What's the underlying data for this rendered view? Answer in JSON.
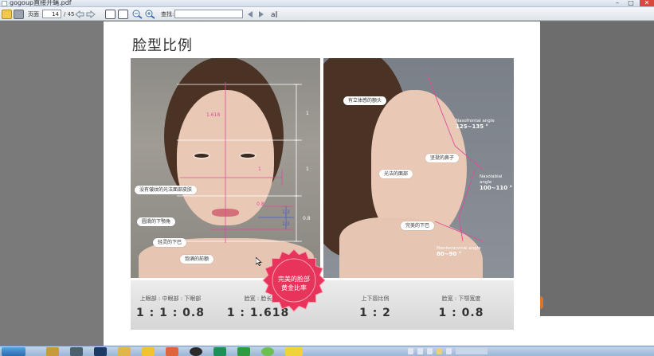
{
  "window": {
    "title": "gogoup直接开蝇.pdf",
    "minimize": "–",
    "maximize": "□",
    "close": "✕"
  },
  "toolbar": {
    "page_label": "页面",
    "page_current": "14",
    "page_total": "/ 45",
    "find_label": "查找:",
    "find_placeholder": "",
    "icons": [
      "open-icon",
      "print-icon",
      "back-icon",
      "forward-icon",
      "fit-page-icon",
      "fit-width-icon",
      "zoom-out-icon",
      "zoom-in-icon",
      "prev-result-icon",
      "next-result-icon",
      "find-options-icon"
    ]
  },
  "page": {
    "title": "脸型比例",
    "left_photo": {
      "callouts": [
        "没有皱纹的光洁面部皮肤",
        "圆滑的下颚角",
        "轻灵的下巴",
        "饱满的前额"
      ],
      "labels": {
        "golden": "1.618",
        "one_a": "1",
        "one_b": "1",
        "one_c": "1",
        "point8_a": "0.8",
        "point8_b": "0.8",
        "third_a": "1/3",
        "third_b": "2/3"
      }
    },
    "right_photo": {
      "callouts": [
        "有立体感的额头",
        "坚挺的鼻子",
        "光洁的面部",
        "完美的下巴"
      ],
      "angles": [
        {
          "name": "Nasofrontal angle",
          "value": "125~135 °"
        },
        {
          "name": "Nasolabial angle",
          "value": "100~110 °"
        },
        {
          "name": "Mentocervical angle",
          "value": "80~90 °"
        }
      ]
    },
    "stats": [
      {
        "label": "上眼部 : 中眼部 : 下眼部",
        "value": "1 : 1 : 0.8"
      },
      {
        "label": "脸宽 : 脸长",
        "value": "1 : 1.618"
      },
      {
        "label": "上下唇比例",
        "value": "1 : 2"
      },
      {
        "label": "脸宽 : 下颚宽度",
        "value": "1 : 0.8"
      }
    ],
    "seal": {
      "line1": "完美的脸部",
      "line2": "黄金比率"
    }
  },
  "colors": {
    "seal": "#e8335a",
    "guide_pink": "#e04a9a",
    "guide_white": "#ffffff",
    "taskbar": "#a9c0de"
  },
  "taskbar": {
    "apps": [
      "start-icon",
      "explorer-icon",
      "media-icon",
      "photoshop-icon",
      "folder-icon",
      "qq-icon",
      "paint-icon",
      "clock-app-icon",
      "app-icon",
      "excel-icon",
      "ball-icon",
      "yellow-app-icon"
    ],
    "tray": [
      "network-icon",
      "volume-icon",
      "ime-icon",
      "shield-icon",
      "update-icon",
      "clock-icon"
    ]
  }
}
